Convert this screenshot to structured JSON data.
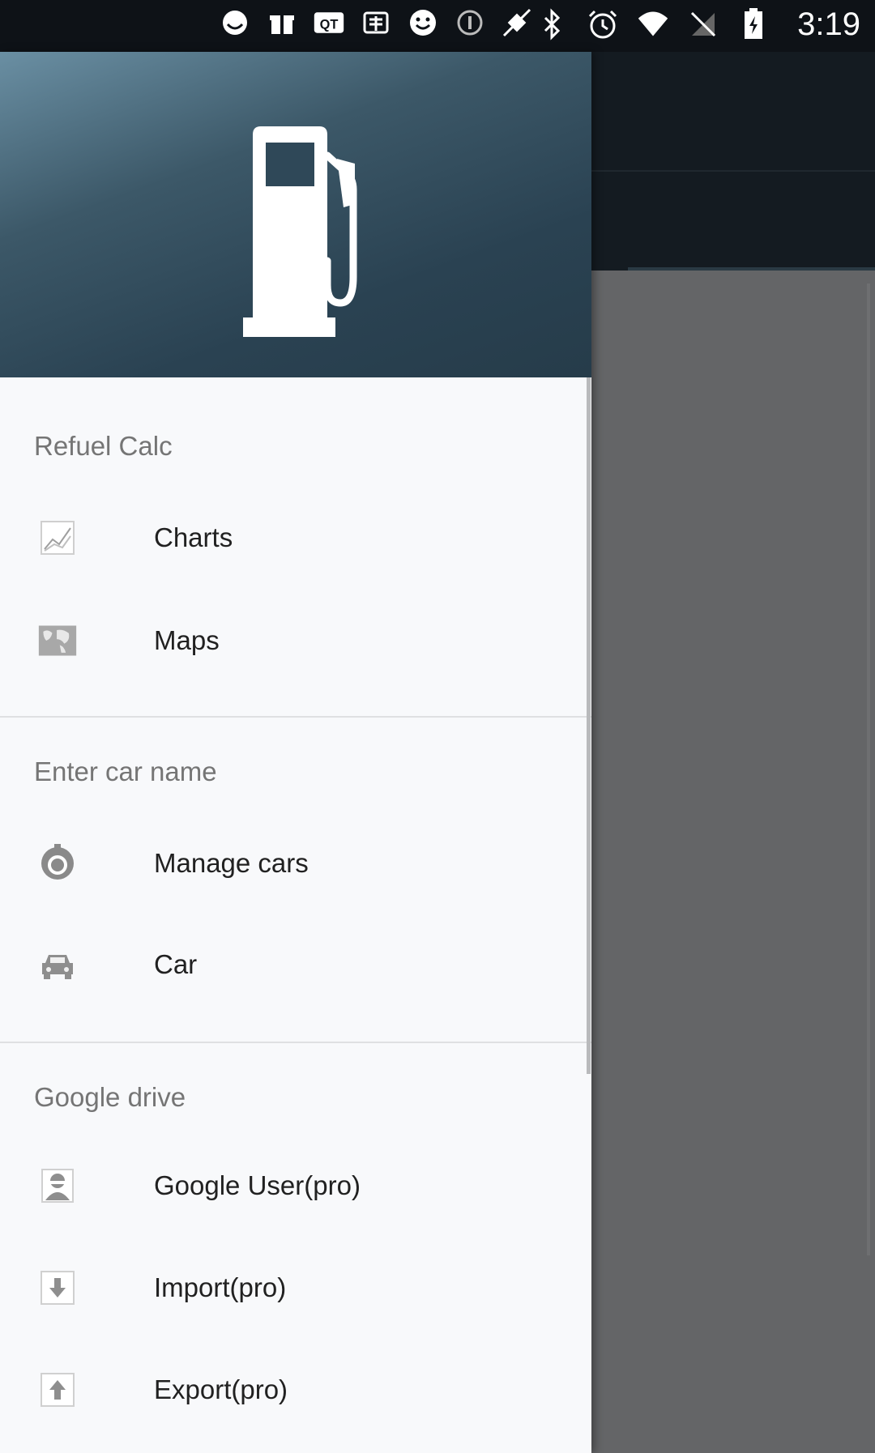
{
  "status_bar": {
    "time": "3:19",
    "left_icons": [
      "emoji-icon",
      "gift-icon",
      "qt-app-icon",
      "taobao-icon",
      "smiley-icon",
      "info-icon",
      "fake-gps-icon"
    ],
    "right_icons": [
      "bluetooth-icon",
      "alarm-icon",
      "wifi-icon",
      "no-sim-icon",
      "battery-charging-icon"
    ]
  },
  "drawer": {
    "header_image": "fuel-pump-icon",
    "sections": [
      {
        "title": "Refuel Calc",
        "items": [
          {
            "label": "Charts",
            "icon": "chart-icon"
          },
          {
            "label": "Maps",
            "icon": "map-icon"
          }
        ]
      },
      {
        "title": "Enter car name",
        "items": [
          {
            "label": "Manage cars",
            "icon": "settings-icon"
          },
          {
            "label": "Car",
            "icon": "car-icon"
          }
        ]
      },
      {
        "title": "Google drive",
        "items": [
          {
            "label": "Google User(pro)",
            "icon": "user-icon"
          },
          {
            "label": "Import(pro)",
            "icon": "import-icon"
          },
          {
            "label": "Export(pro)",
            "icon": "export-icon"
          }
        ]
      }
    ]
  },
  "colors": {
    "status_bar": "#0e1217",
    "drawer_bg": "#f8f9fb",
    "header_dark": "#263c4a",
    "header_light": "#6a8fa3",
    "scrim": "#5f6062",
    "icon_gray": "#9e9e9e"
  }
}
